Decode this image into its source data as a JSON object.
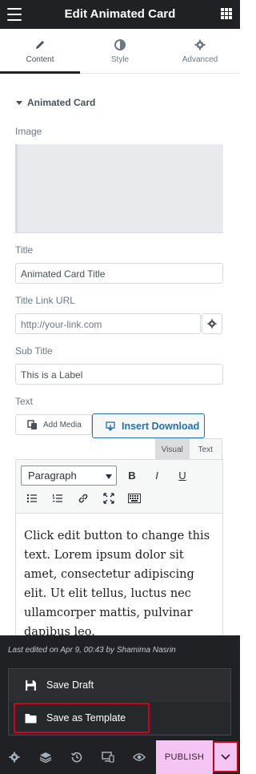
{
  "header": {
    "title": "Edit Animated Card"
  },
  "tabs": [
    {
      "label": "Content",
      "icon": "pencil-icon"
    },
    {
      "label": "Style",
      "icon": "contrast-icon"
    },
    {
      "label": "Advanced",
      "icon": "gear-icon"
    }
  ],
  "section": {
    "title": "Animated Card"
  },
  "fields": {
    "image_label": "Image",
    "title_label": "Title",
    "title_value": "Animated Card Title",
    "link_label": "Title Link URL",
    "link_placeholder": "http://your-link.com",
    "subtitle_label": "Sub Title",
    "subtitle_value": "This is a Label",
    "text_label": "Text"
  },
  "editor": {
    "add_media": "Add Media",
    "insert_download": "Insert Download",
    "tab_visual": "Visual",
    "tab_text": "Text",
    "format_select": "Paragraph",
    "content": "Click edit button to change this text. Lorem ipsum dolor sit amet, consectetur adipiscing elit. Ut elit tellus, luctus nec ullamcorper mattis, pulvinar dapibus leo."
  },
  "panel": {
    "last_edited": "Last edited on Apr 9, 00:43 by Shamima Nasrin",
    "save_draft": "Save Draft",
    "save_template": "Save as Template"
  },
  "footer": {
    "publish": "PUBLISH",
    "icons": [
      "settings-icon",
      "layers-icon",
      "history-icon",
      "responsive-icon",
      "preview-icon"
    ]
  },
  "colors": {
    "dark": "#1f2124",
    "publish_bg": "#f4c5f2",
    "highlight": "#d0021b",
    "download_blue": "#2271b1"
  }
}
